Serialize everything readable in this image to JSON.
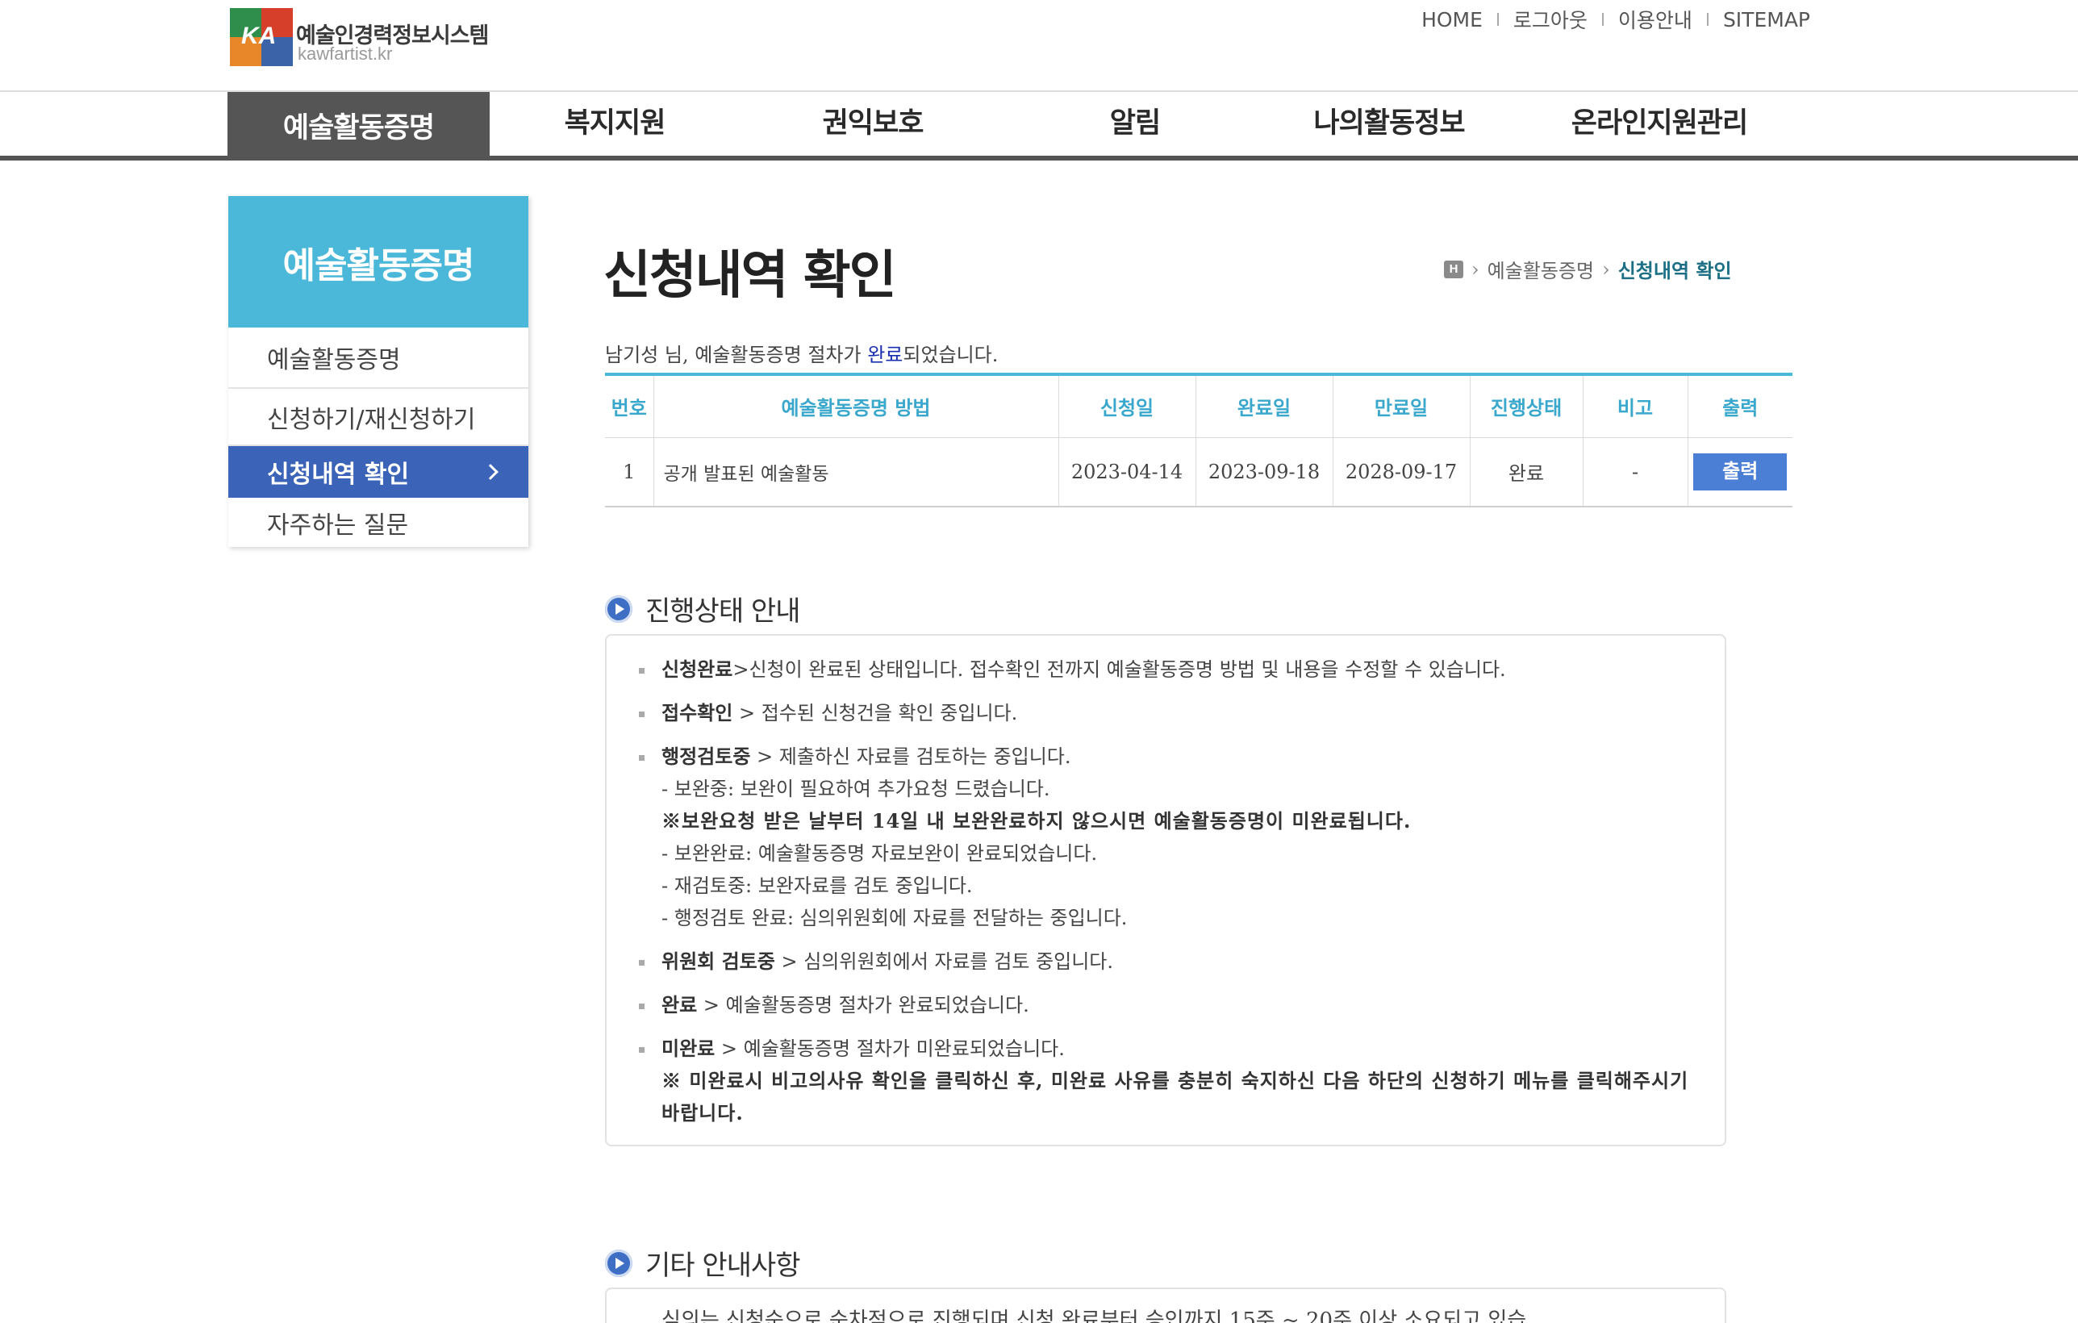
{
  "header": {
    "logo_title": "예술인경력정보시스템",
    "logo_sub": "kawfartist.kr",
    "logo_mark": "KA",
    "util_links": [
      "HOME",
      "로그아웃",
      "이용안내",
      "SITEMAP"
    ]
  },
  "gnb": {
    "items": [
      "예술활동증명",
      "복지지원",
      "권익보호",
      "알림",
      "나의활동정보",
      "온라인지원관리"
    ],
    "active_index": 0
  },
  "lnb": {
    "title": "예술활동증명",
    "items": [
      "예술활동증명",
      "신청하기/재신청하기",
      "신청내역 확인",
      "자주하는 질문"
    ],
    "active_index": 2
  },
  "page": {
    "title": "신청내역 확인",
    "breadcrumb": [
      "예술활동증명",
      "신청내역 확인"
    ],
    "home_badge": "H",
    "intro_prefix": "남기성 님, 예술활동증명 절차가 ",
    "intro_highlight": "완료",
    "intro_suffix": "되었습니다."
  },
  "table": {
    "headers": [
      "번호",
      "예술활동증명 방법",
      "신청일",
      "완료일",
      "만료일",
      "진행상태",
      "비고",
      "출력"
    ],
    "rows": [
      {
        "no": "1",
        "method": "공개 발표된 예술활동",
        "applied": "2023-04-14",
        "completed": "2023-09-18",
        "expires": "2028-09-17",
        "status": "완료",
        "remark": "-",
        "print_label": "출력"
      }
    ]
  },
  "guide": {
    "title": "진행상태 안내",
    "items": [
      {
        "term": "신청완료",
        "desc": ">신청이 완료된 상태입니다. 접수확인 전까지 예술활동증명 방법 및 내용을 수정할 수 있습니다."
      },
      {
        "term": "접수확인",
        "desc": " > 접수된 신청건을 확인 중입니다."
      },
      {
        "term": "행정검토중",
        "desc": " > 제출하신 자료를 검토하는 중입니다.",
        "sub1": "- 보완중: 보완이 필요하여 추가요청 드렸습니다.",
        "note": "※보완요청 받은 날부터 14일 내 보완완료하지 않으시면 예술활동증명이 미완료됩니다.",
        "sub2": "- 보완완료: 예술활동증명 자료보완이 완료되었습니다.",
        "sub3": "- 재검토중: 보완자료를 검토 중입니다.",
        "sub4": "- 행정검토 완료: 심의위원회에 자료를 전달하는 중입니다."
      },
      {
        "term": "위원회 검토중",
        "desc": " > 심의위원회에서 자료를 검토 중입니다."
      },
      {
        "term": "완료",
        "desc": " > 예술활동증명 절차가 완료되었습니다."
      },
      {
        "term": "미완료",
        "desc": " > 예술활동증명 절차가 미완료되었습니다.",
        "note": "※ 미완료시 비고의사유 확인을 클릭하신 후, 미완료 사유를 충분히 숙지하신 다음 하단의 신청하기 메뉴를 클릭해주시기 바랍니다."
      }
    ]
  },
  "other": {
    "title": "기타 안내사항",
    "partial_text": "심의는 신청순으로 순차적으로 진행되며 신청 완료부터 승인까지 15주 ~ 20주 이상 소요되고 있습"
  },
  "colors": {
    "lnb_head": "#4bb8d9",
    "lnb_active": "#3b63b8",
    "gnb_active": "#555555",
    "table_header_text": "#3aa7cc",
    "print_button": "#4b7fd6",
    "intro_highlight": "#1a2fb0",
    "breadcrumb_current": "#1d6f86"
  }
}
